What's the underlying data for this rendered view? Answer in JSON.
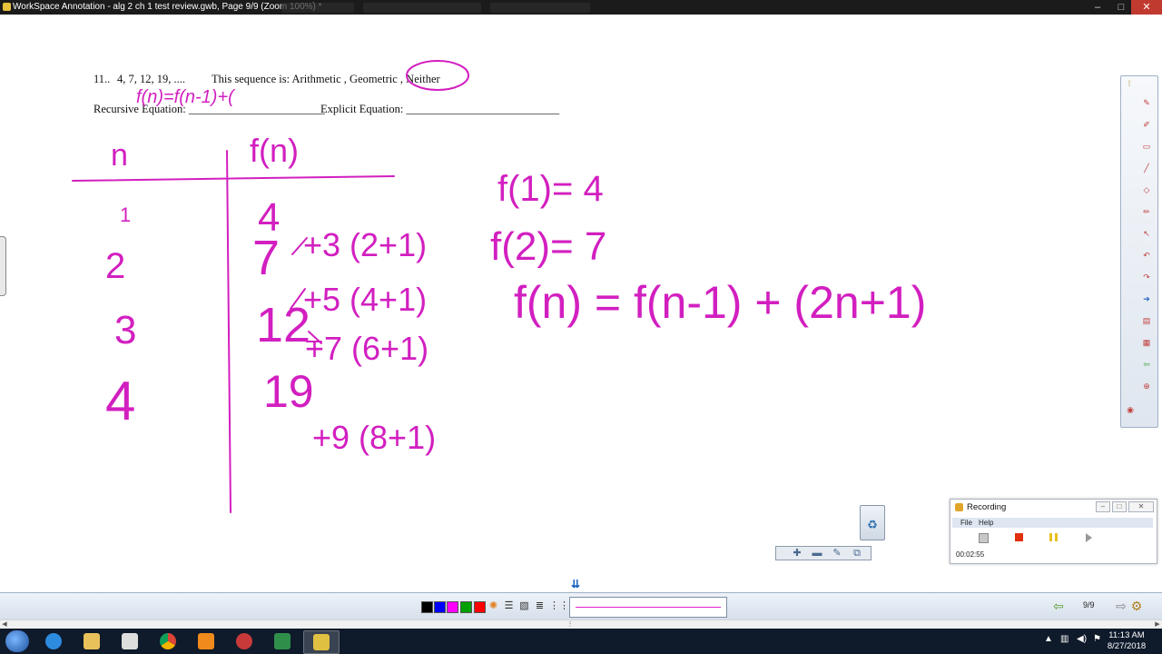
{
  "window": {
    "title": "WorkSpace Annotation - alg 2 ch 1 test review.gwb, Page 9/9  (Zoom 100%) *",
    "minimize": "–",
    "maximize": "□",
    "close": "✕"
  },
  "document": {
    "question_number": "11..",
    "sequence": "4, 7, 12, 19, ....",
    "sequence_prompt": "This sequence is:  Arithmetic , Geometric , Neither",
    "recursive_label": "Recursive Equation: ________________________",
    "explicit_label": "Explicit Equation: ___________________________"
  },
  "ink_notes": {
    "color": "#d21fc0",
    "recursive_answer": "f(n)=f(n-1)+(",
    "table_header_n": "n",
    "table_header_fn": "f(n)",
    "n_values": [
      "1",
      "2",
      "3",
      "4"
    ],
    "fn_values": [
      "4",
      "7",
      "12",
      "19"
    ],
    "differences": [
      "+3 (2+1)",
      "+5 (4+1)",
      "+7 (6+1)",
      "+9 (8+1)"
    ],
    "f1": "f(1)= 4",
    "f2": "f(2)= 7",
    "formula": "f(n) = f(n-1) + (2n+1)"
  },
  "recording": {
    "title": "Recording",
    "menu_file": "File",
    "menu_help": "Help",
    "elapsed": "00:02:55"
  },
  "bottom_toolbar": {
    "page_indicator": "9/9",
    "colors": [
      "#000000",
      "#0000ff",
      "#ff00ff",
      "#00a000",
      "#ff0000"
    ],
    "pen_color": "#e020c8"
  },
  "taskbar": {
    "time": "11:13 AM",
    "date": "8/27/2018"
  }
}
